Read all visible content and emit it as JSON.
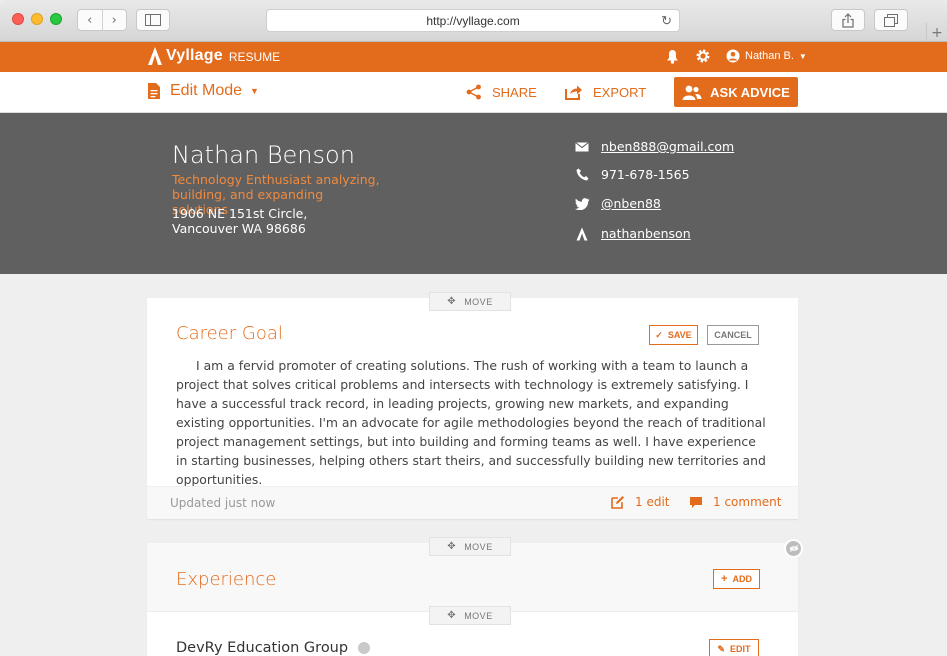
{
  "browser": {
    "url": "http://vyllage.com"
  },
  "appbar": {
    "brand": "Vyllage",
    "product": "RESUME",
    "user_name": "Nathan B."
  },
  "toolbar": {
    "edit_mode": "Edit Mode",
    "share": "SHARE",
    "export": "EXPORT",
    "ask_advice": "ASK ADVICE"
  },
  "profile": {
    "name": "Nathan Benson",
    "tagline": "Technology Enthusiast analyzing, building, and expanding solutions",
    "address": "1906 NE 151st Circle, Vancouver WA 98686",
    "email": "nben888@gmail.com",
    "phone": "971-678-1565",
    "twitter": "@nben88",
    "vyllage": "nathanbenson"
  },
  "career_goal": {
    "move_label": "MOVE",
    "title": "Career Goal",
    "save_label": "SAVE",
    "cancel_label": "CANCEL",
    "text": "I am a fervid promoter of creating solutions. The rush of working with a team to launch a project that solves critical problems and intersects with technology is extremely satisfying. I have a successful track record, in leading projects, growing new markets, and expanding existing opportunities. I'm an advocate for agile methodologies beyond the reach of traditional project management settings, but into building and forming teams as well. I have experience in starting businesses, helping others start theirs, and successfully building new territories and opportunities.",
    "updated": "Updated just now",
    "edits": "1 edit",
    "comments": "1 comment"
  },
  "experience": {
    "move_label": "MOVE",
    "title": "Experience",
    "add_label": "ADD",
    "item_move_label": "MOVE",
    "item_title": "DevRy Education Group",
    "item_edit_label": "EDIT"
  },
  "colors": {
    "accent": "#e36b1c",
    "header_bg": "#606060"
  }
}
